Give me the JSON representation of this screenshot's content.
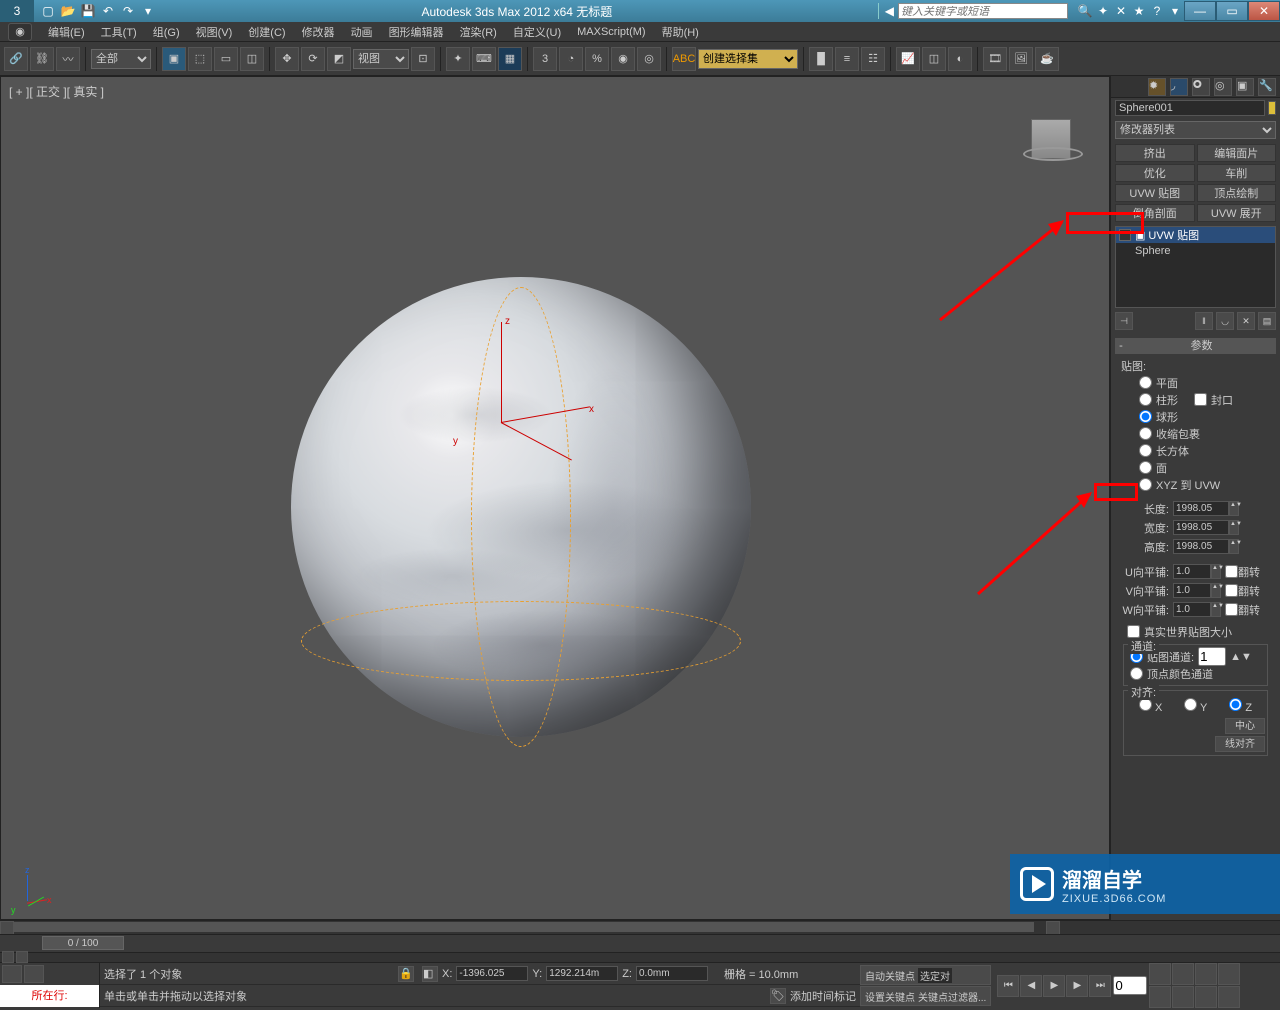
{
  "titlebar": {
    "app_title": "Autodesk 3ds Max 2012 x64   无标题",
    "search_placeholder": "键入关键字或短语"
  },
  "menu": {
    "items": [
      "编辑(E)",
      "工具(T)",
      "组(G)",
      "视图(V)",
      "创建(C)",
      "修改器",
      "动画",
      "图形编辑器",
      "渲染(R)",
      "自定义(U)",
      "MAXScript(M)",
      "帮助(H)"
    ]
  },
  "toolbar": {
    "filter_dropdown": "全部",
    "view_dropdown": "视图",
    "selset_dropdown": "创建选择集"
  },
  "viewport": {
    "label": "[ + ][ 正交 ][ 真实 ]",
    "axes": {
      "x": "x",
      "y": "y",
      "z": "z"
    }
  },
  "cmd": {
    "object_name": "Sphere001",
    "modlist_label": "修改器列表",
    "mod_buttons": [
      "挤出",
      "编辑面片",
      "优化",
      "车削",
      "UVW 贴图",
      "顶点绘制",
      "倒角剖面",
      "UVW 展开"
    ],
    "stack": {
      "row0": "UVW 贴图",
      "row1": "Sphere"
    },
    "rollout0_title": "参数",
    "map_label": "贴图:",
    "map_types": [
      "平面",
      "柱形",
      "球形",
      "收缩包裹",
      "长方体",
      "面",
      "XYZ 到 UVW"
    ],
    "cap_label": "封口",
    "dim": {
      "l_label": "长度:",
      "l_val": "1998.05",
      "w_label": "宽度:",
      "w_val": "1998.05",
      "h_label": "高度:",
      "h_val": "1998.05"
    },
    "tile": {
      "u_label": "U向平铺:",
      "u_val": "1.0",
      "v_label": "V向平铺:",
      "v_val": "1.0",
      "w_label": "W向平铺:",
      "w_val": "1.0",
      "flip_label": "翻转"
    },
    "real_world": "真实世界贴图大小",
    "channel": {
      "title": "通道:",
      "map_channel_label": "贴图通道:",
      "map_channel_val": "1",
      "vcol_label": "顶点颜色通道"
    },
    "align": {
      "title": "对齐:",
      "axes": [
        "X",
        "Y",
        "Z"
      ],
      "center": "中心",
      "normal": "线对齐"
    }
  },
  "timeline": {
    "slider_label": "0 / 100"
  },
  "status": {
    "line1": "选择了 1 个对象",
    "line2": "单击或单击并拖动以选择对象",
    "script_label": "所在行:",
    "x": "X:",
    "x_val": "-1396.025",
    "y": "Y:",
    "y_val": "1292.214m",
    "z": "Z:",
    "z_val": "0.0mm",
    "grid": "栅格 = 10.0mm",
    "autokey": "自动关键点",
    "selset": "选定对",
    "setkey": "设置关键点",
    "keyfilter": "关键点过滤器...",
    "addtime": "添加时间标记"
  },
  "watermark": {
    "brand": "溜溜自学",
    "url": "ZIXUE.3D66.COM"
  }
}
